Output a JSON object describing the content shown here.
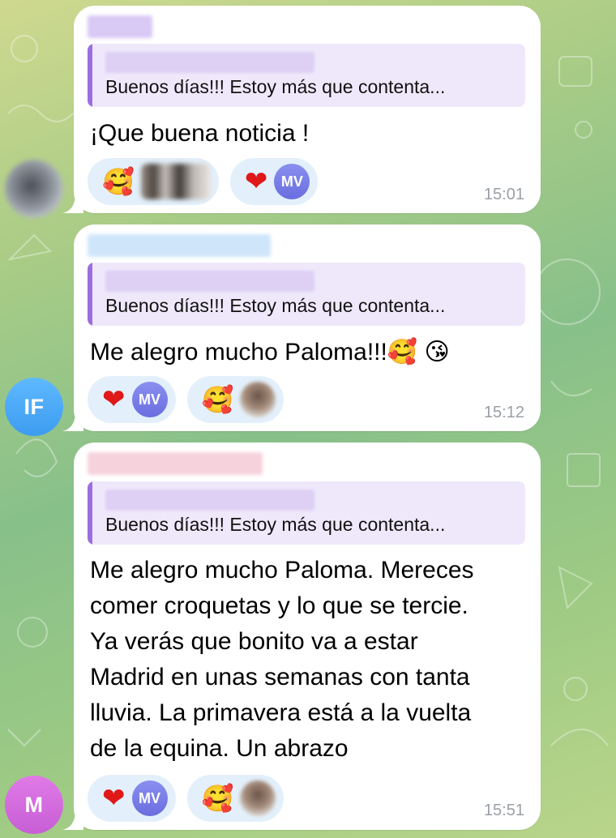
{
  "colors": {
    "accent_purple": "#9c6ee0",
    "reply_bg": "#efe8fb",
    "reaction_bg": "#e3f0fb",
    "time_gray": "#9aa0a6"
  },
  "avatars": {
    "if_initials": "IF",
    "m_initials": "M"
  },
  "messages": [
    {
      "reply_quote": "Buenos días!!! Estoy más que contenta...",
      "text": "¡Que buena noticia !",
      "reactions": [
        {
          "emoji": "🥰",
          "users": "blurred-photo"
        },
        {
          "emoji": "❤️",
          "users": "MV"
        }
      ],
      "time": "15:01"
    },
    {
      "reply_quote": "Buenos días!!! Estoy más que contenta...",
      "text": "Me alegro mucho Paloma!!!🥰 😘",
      "reactions": [
        {
          "emoji": "❤️",
          "users": "MV"
        },
        {
          "emoji": "🥰",
          "users": "blurred-photo"
        }
      ],
      "time": "15:12"
    },
    {
      "reply_quote": "Buenos días!!! Estoy más que contenta...",
      "text_lines": [
        "Me alegro mucho Paloma. Mereces",
        "comer croquetas y lo que se tercie.",
        "Ya verás que bonito va a estar",
        "Madrid en unas semanas con tanta",
        "lluvia. La primavera está a la vuelta",
        "de la equina. Un abrazo"
      ],
      "reactions": [
        {
          "emoji": "❤️",
          "users": "MV"
        },
        {
          "emoji": "🥰",
          "users": "blurred-photo"
        }
      ],
      "time": "15:51"
    }
  ]
}
